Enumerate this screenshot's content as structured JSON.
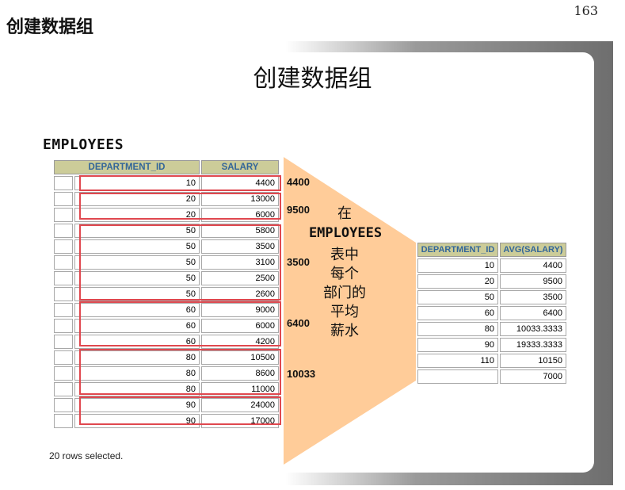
{
  "page": {
    "header": "创建数据组",
    "number": "163"
  },
  "slide": {
    "title": "创建数据组",
    "table_caption": "EMPLOYEES",
    "funnel_text": {
      "line1": "在",
      "line2": "EMPLOYEES",
      "line3": "表中",
      "line4": "每个",
      "line5": "部门的",
      "line6": "平均",
      "line7": "薪水"
    },
    "rows_selected": "20 rows selected.",
    "group_avgs": [
      "4400",
      "9500",
      "3500",
      "6400",
      "10033"
    ],
    "colors": {
      "funnel": "#ffcc99",
      "header_bg": "#cccc99",
      "header_text": "#336699",
      "group_box": "#e0484f"
    }
  },
  "employees": {
    "columns": [
      "DEPARTMENT_ID",
      "SALARY"
    ],
    "rows": [
      [
        "10",
        "4400"
      ],
      [
        "20",
        "13000"
      ],
      [
        "20",
        "6000"
      ],
      [
        "50",
        "5800"
      ],
      [
        "50",
        "3500"
      ],
      [
        "50",
        "3100"
      ],
      [
        "50",
        "2500"
      ],
      [
        "50",
        "2600"
      ],
      [
        "60",
        "9000"
      ],
      [
        "60",
        "6000"
      ],
      [
        "60",
        "4200"
      ],
      [
        "80",
        "10500"
      ],
      [
        "80",
        "8600"
      ],
      [
        "80",
        "11000"
      ],
      [
        "90",
        "24000"
      ],
      [
        "90",
        "17000"
      ]
    ]
  },
  "avg_result": {
    "columns": [
      "DEPARTMENT_ID",
      "AVG(SALARY)"
    ],
    "rows": [
      [
        "10",
        "4400"
      ],
      [
        "20",
        "9500"
      ],
      [
        "50",
        "3500"
      ],
      [
        "60",
        "6400"
      ],
      [
        "80",
        "10033.3333"
      ],
      [
        "90",
        "19333.3333"
      ],
      [
        "110",
        "10150"
      ],
      [
        "",
        "7000"
      ]
    ]
  }
}
